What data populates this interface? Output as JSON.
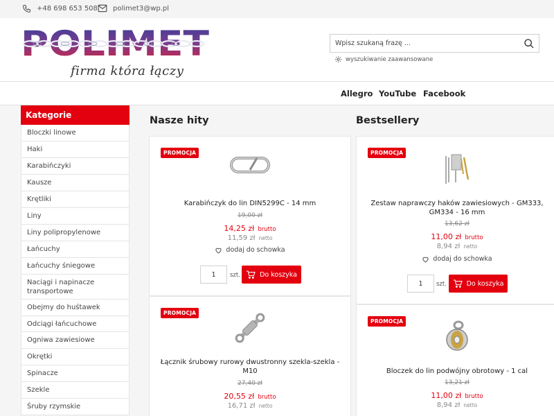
{
  "contact": {
    "phone": "+48 698 653 508",
    "email": "polimet3@wp.pl"
  },
  "logo": {
    "name": "POLIMET",
    "tagline": "firma która łączy"
  },
  "search": {
    "placeholder": "Wpisz szukaną frazę ...",
    "advanced_label": "wyszukiwanie zaawansowane"
  },
  "nav": [
    "Allegro",
    "YouTube",
    "Facebook"
  ],
  "sidebar": {
    "title": "Kategorie",
    "items": [
      "Bloczki linowe",
      "Haki",
      "Karabińczyki",
      "Kausze",
      "Krętliki",
      "Liny",
      "Liny polipropylenowe",
      "Łańcuchy",
      "Łańcuchy śniegowe",
      "Naciągi i napinacze transportowe",
      "Obejmy do huśtawek",
      "Odciągi łańcuchowe",
      "Ogniwa zawiesiowe",
      "Okrętki",
      "Spinacze",
      "Szekle",
      "Śruby rzymskie"
    ]
  },
  "sections": {
    "hits_title": "Nasze hity",
    "best_title": "Bestsellery"
  },
  "labels": {
    "badge": "PROMOCJA",
    "gross": "brutto",
    "net": "netto",
    "favorite": "dodaj do schowka",
    "unit": "szt.",
    "cart": "Do koszyka",
    "qty": "1"
  },
  "products": {
    "hit1": {
      "name": "Karabińczyk do lin DIN5299C - 14 mm",
      "old_price": "19,00 zł",
      "price": "14,25 zł",
      "net_price": "11,59 zł"
    },
    "hit2": {
      "name": "Łącznik śrubowy rurowy dwustronny szekla-szekla - M10",
      "old_price": "27,40 zł",
      "price": "20,55 zł",
      "net_price": "16,71 zł"
    },
    "best1": {
      "name": "Zestaw naprawczy haków zawiesiowych - GM333, GM334 - 16 mm",
      "old_price": "13,62 zł",
      "price": "11,00 zł",
      "net_price": "8,94 zł"
    },
    "best2": {
      "name": "Bloczek do lin podwójny obrotowy - 1 cal",
      "old_price": "13,21 zł",
      "price": "11,00 zł",
      "net_price": "8,94 zł"
    }
  }
}
